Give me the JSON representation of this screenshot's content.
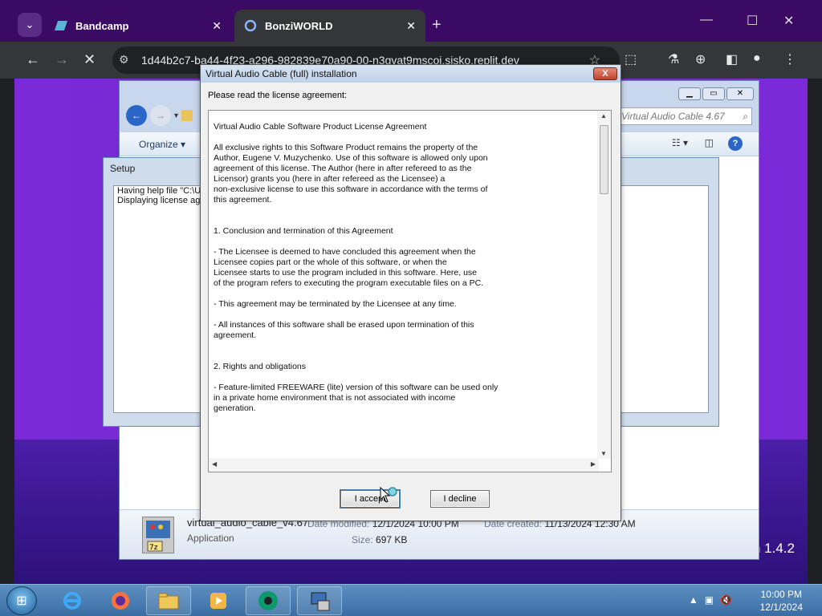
{
  "browser": {
    "tabs": [
      {
        "title": "Bandcamp",
        "active": false,
        "icon": "bandcamp-icon"
      },
      {
        "title": "BonziWORLD",
        "active": true,
        "icon": "bonziworld-icon"
      }
    ],
    "url": "1d44b2c7-ba44-4f23-a296-982839e70a90-00-n3gvat9mscoi.sisko.replit.dev"
  },
  "explorer": {
    "search_placeholder": "Virtual Audio Cable 4.67",
    "organize_label": "Organize ▾",
    "details": {
      "filename": "virtual_audio_cable_v4.67",
      "type": "Application",
      "date_modified_label": "Date modified:",
      "date_modified": "12/1/2024 10:00 PM",
      "date_created_label": "Date created:",
      "date_created": "11/13/2024 12:30 AM",
      "size_label": "Size:",
      "size": "697 KB"
    }
  },
  "setup": {
    "title": "Setup",
    "lines": [
      "Having help file \"C:\\U",
      "Displaying license agr"
    ]
  },
  "dialog": {
    "title": "Virtual Audio Cable (full) installation",
    "close_label": "X",
    "prompt": "Please read the license agreement:",
    "license_paragraphs": [
      "Virtual Audio Cable Software Product License Agreement",
      "All exclusive rights to this Software Product remains the property of the\nAuthor, Eugene V. Muzychenko. Use of this software is allowed only upon\nagreement of this license. The Author (here in after refereed to as the\nLicensor) grants you (here in after refereed as the Licensee) a\nnon-exclusive license to use this software in accordance with the terms of\nthis agreement.",
      "1. Conclusion and termination of this Agreement",
      "- The Licensee is deemed to have concluded this agreement when the\nLicensee copies part or the whole of this software, or when the\nLicensee starts to use the program included in this software. Here, use\nof the program refers to executing the program executable files on a PC.",
      "- This agreement may be terminated by the Licensee at any time.",
      "- All instances of this software shall be erased upon termination of this\nagreement.",
      "2. Rights and obligations",
      "- Feature-limited FREEWARE (lite) version of this software can be used only\nin a private home environment that is not associated with income\ngeneration."
    ],
    "accept_label": "I accept",
    "decline_label": "I decline"
  },
  "desktop": {
    "version_text": "n 1.4.2"
  },
  "taskbar": {
    "time": "10:00 PM",
    "date": "12/1/2024"
  }
}
